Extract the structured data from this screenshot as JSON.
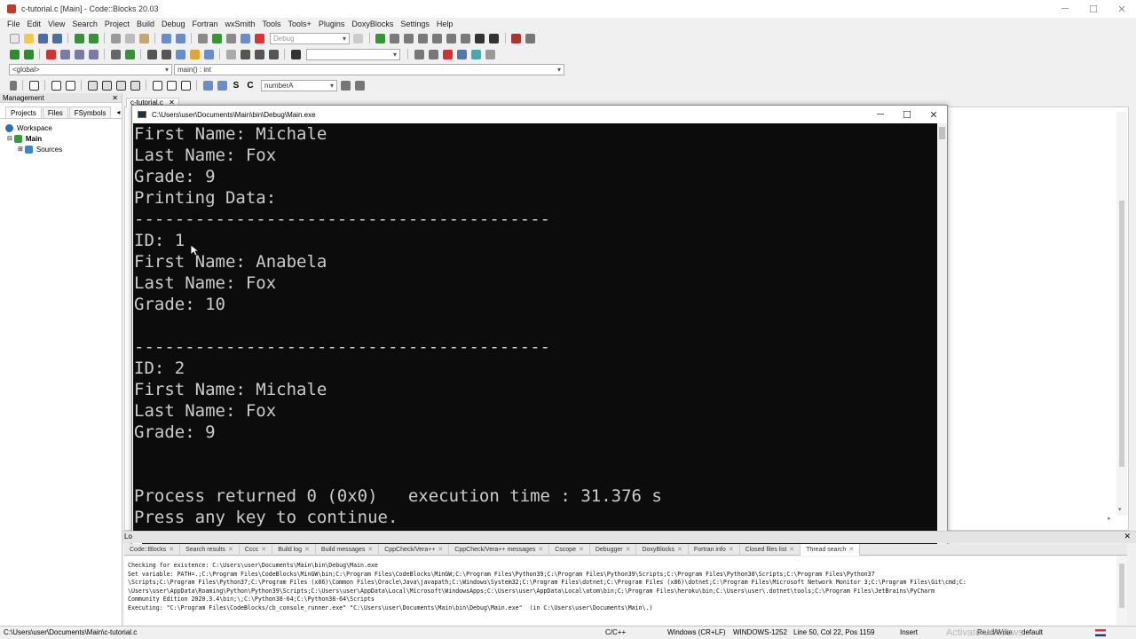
{
  "window": {
    "title": "c-tutorial.c [Main] - Code::Blocks 20.03"
  },
  "menu": [
    "File",
    "Edit",
    "View",
    "Search",
    "Project",
    "Build",
    "Debug",
    "Fortran",
    "wxSmith",
    "Tools",
    "Tools+",
    "Plugins",
    "DoxyBlocks",
    "Settings",
    "Help"
  ],
  "toolbar": {
    "build_target": "Debug",
    "scope": "<global>",
    "function": "main() : int",
    "search_value": "numberA"
  },
  "management": {
    "title": "Management",
    "tabs": [
      "Projects",
      "Files",
      "FSymbols"
    ],
    "tree": [
      {
        "label": "Workspace",
        "level": 0
      },
      {
        "label": "Main",
        "level": 1
      },
      {
        "label": "Sources",
        "level": 2
      }
    ]
  },
  "editor": {
    "tab_label": "c-tutorial.c"
  },
  "console": {
    "title": "C:\\Users\\user\\Documents\\Main\\bin\\Debug\\Main.exe",
    "lines": [
      "First Name: Michale",
      "Last Name: Fox",
      "Grade: 9",
      "Printing Data:",
      "-----------------------------------------",
      "ID: 1",
      "First Name: Anabela",
      "Last Name: Fox",
      "Grade: 10",
      "",
      "-----------------------------------------",
      "ID: 2",
      "First Name: Michale",
      "Last Name: Fox",
      "Grade: 9",
      "",
      "",
      "Process returned 0 (0x0)   execution time : 31.376 s",
      "Press any key to continue."
    ]
  },
  "logs": {
    "header": "Lo",
    "tabs": [
      "Code::Blocks",
      "Search results",
      "Cccc",
      "Build log",
      "Build messages",
      "CppCheck/Vera++",
      "CppCheck/Vera++ messages",
      "Cscope",
      "Debugger",
      "DoxyBlocks",
      "Fortran info",
      "Closed files list",
      "Thread search"
    ],
    "lines": [
      "Checking for existence: C:\\Users\\user\\Documents\\Main\\bin\\Debug\\Main.exe",
      "Set variable: PATH=.;C:\\Program Files\\CodeBlocks\\MinGW\\bin;C:\\Program Files\\CodeBlocks\\MinGW;C:\\Program Files\\Python39;C:\\Program Files\\Python39\\Scripts;C:\\Program Files\\Python38\\Scripts;C:\\Program Files\\Python37",
      "\\Scripts;C:\\Program Files\\Python37;C:\\Program Files (x86)\\Common Files\\Oracle\\Java\\javapath;C:\\Windows\\System32;C:\\Program Files\\dotnet;C:\\Program Files (x86)\\dotnet;C:\\Program Files\\Microsoft Network Monitor 3;C:\\Program Files\\Git\\cmd;C:",
      "\\Users\\user\\AppData\\Roaming\\Python\\Python39\\Scripts;C:\\Users\\user\\AppData\\Local\\Microsoft\\WindowsApps;C:\\Users\\user\\AppData\\Local\\atom\\bin;C:\\Program Files\\heroku\\bin;C:\\Users\\user\\.dotnet\\tools;C:\\Program Files\\JetBrains\\PyCharm",
      "Community Edition 2020.3.4\\bin;\\;C:\\Python38-64;C:\\Python38-64\\Scripts",
      "Executing: \"C:\\Program Files\\CodeBlocks/cb_console_runner.exe\" \"C:\\Users\\user\\Documents\\Main\\bin\\Debug\\Main.exe\"  (in C:\\Users\\user\\Documents\\Main\\.)"
    ]
  },
  "status": {
    "path": "C:\\Users\\user\\Documents\\Main\\c-tutorial.c",
    "language": "C/C++",
    "line_endings": "Windows (CR+LF)",
    "encoding": "WINDOWS-1252",
    "position": "Line 50, Col 22, Pos 1159",
    "mode": "Insert",
    "access": "Read/Write",
    "profile": "default"
  },
  "watermark": "Activate Windows"
}
